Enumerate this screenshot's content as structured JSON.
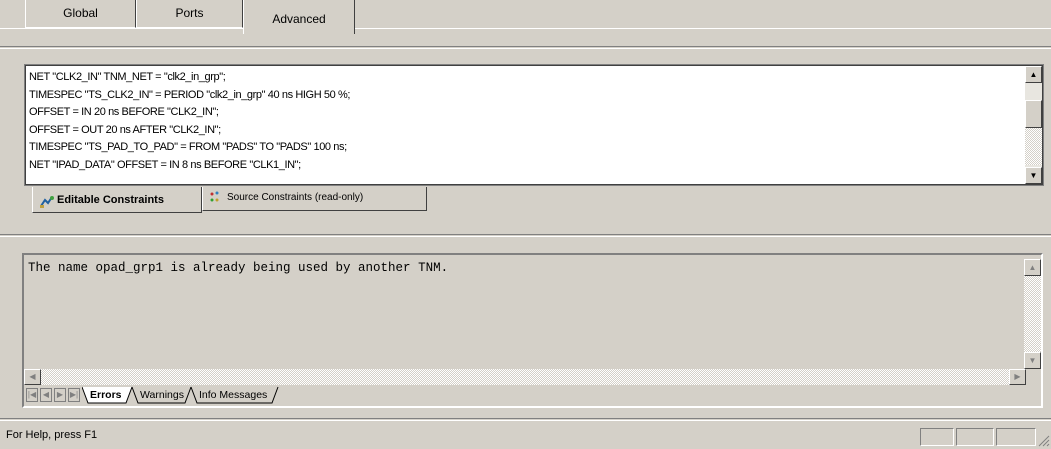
{
  "top_tabs": [
    "Global",
    "Ports",
    "Advanced"
  ],
  "constraints": {
    "lines": [
      "NET \"CLK2_IN\" TNM_NET = \"clk2_in_grp\";",
      "TIMESPEC \"TS_CLK2_IN\" = PERIOD \"clk2_in_grp\" 40 ns HIGH 50 %;",
      "OFFSET = IN 20 ns BEFORE \"CLK2_IN\";",
      "OFFSET = OUT 20 ns AFTER \"CLK2_IN\";",
      "TIMESPEC \"TS_PAD_TO_PAD\" = FROM \"PADS\" TO \"PADS\" 100 ns;",
      "NET \"IPAD_DATA\" OFFSET = IN 8 ns BEFORE \"CLK1_IN\";"
    ],
    "tabs": [
      "Editable Constraints",
      "Source Constraints (read-only)"
    ]
  },
  "messages": {
    "text": "The name opad_grp1 is already being used by another TNM.",
    "tabs": [
      "Errors",
      "Warnings",
      "Info Messages"
    ]
  },
  "status": {
    "help_text": "For Help, press F1"
  },
  "icons": {
    "scroll_up": "scroll-up-arrow-icon",
    "scroll_down": "scroll-down-arrow-icon",
    "editable": "editable-constraints-icon",
    "source": "source-constraints-icon"
  }
}
